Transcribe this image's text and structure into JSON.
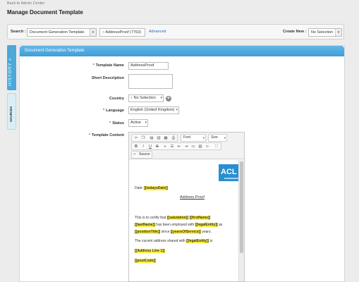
{
  "header": {
    "back_link": "Back to Admin Center",
    "page_title": "Manage Document Template"
  },
  "search": {
    "label": "Search :",
    "type_value": "Document Generation Template",
    "query_value": "AddressProof (7763)",
    "advanced_link": "Advanced",
    "create_label": "Create New :",
    "create_value": "No Selection"
  },
  "side_tabs": {
    "history": "HISTORY",
    "sources": "SOURCES"
  },
  "panel": {
    "title": "Document Generation Template"
  },
  "form": {
    "template_name_label": "Template Name",
    "template_name_value": "AddressProof",
    "short_description_label": "Short Description",
    "short_description_value": "",
    "country_label": "Country",
    "country_value": "No Selection",
    "language_label": "Language",
    "language_value": "English (United Kingdom)",
    "status_label": "Status",
    "status_value": "Active",
    "template_content_label": "Template Content"
  },
  "editor": {
    "font_label": "Font",
    "size_label": "Size",
    "source_label": "Source",
    "bold": "B",
    "italic": "I",
    "underline": "U",
    "strike": "S",
    "logo_text": "ACL"
  },
  "document": {
    "date_prefix": "Date:",
    "date_field": "[[todaysDate]]",
    "title": "Address Proof",
    "p1_a": "This is to certify that",
    "salutation": "[[salutation]]",
    "first_name": "[[firstName]]",
    "last_name": "[[lastName]]",
    "p1_b": "has been employed with",
    "legal_entity": "[[legalEntity]]",
    "p1_as": "as",
    "position_title": "[[positionTitle]]",
    "p1_since": "since",
    "years_of_service": "[[yearsOfService]]",
    "p1_years": "years.",
    "p2_a": "The current address shared with",
    "legal_entity_2": "[[legalEntity]]",
    "p2_is": "is:",
    "address_line_1": "[[Address Line 1]]",
    "post_code": "[[postCode]]"
  },
  "colors": {
    "accent": "#3f9ed6",
    "placeholder_highlight": "#ffef3a",
    "required": "#d33333",
    "background": "#ececec"
  }
}
